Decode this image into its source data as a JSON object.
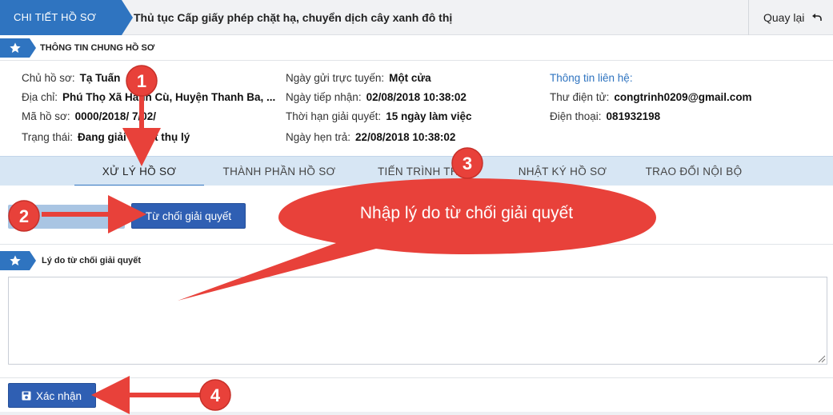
{
  "header": {
    "tag": "CHI TIẾT HỒ SƠ",
    "title": "Thủ tục Cấp giấy phép chặt hạ, chuyển dịch cây xanh đô thị",
    "back_label": "Quay lại"
  },
  "general_section": {
    "title": "THÔNG TIN CHUNG HỒ SƠ"
  },
  "info": {
    "owner_label": "Chủ hồ sơ:",
    "owner_value": "Tạ Tuấn",
    "address_label": "Địa chỉ:",
    "address_value": "Phú Thọ Xã Hanh Cù, Huyện Thanh Ba, ...",
    "code_label": "Mã hồ sơ:",
    "code_value": "0000/2018/ 7/02/",
    "status_label": "Trạng thái:",
    "status_value": "Đang giải quyết thụ lý",
    "submit_label": "Ngày gửi trực tuyến:",
    "submit_value": "Một cửa",
    "received_label": "Ngày tiếp nhận:",
    "received_value": "02/08/2018 10:38:02",
    "deadline_label": "Thời hạn giải quyết:",
    "deadline_value": "15 ngày làm việc",
    "appointment_label": "Ngày hẹn trả:",
    "appointment_value": "22/08/2018 10:38:02",
    "contact_title": "Thông tin liên hệ:",
    "email_label": "Thư điện tử:",
    "email_value": "congtrinh0209@gmail.com",
    "phone_label": "Điện thoại:",
    "phone_value": "081932198"
  },
  "tabs": [
    {
      "label": "XỬ LÝ HỒ SƠ",
      "active": true
    },
    {
      "label": "THÀNH PHẦN HỒ SƠ",
      "active": false
    },
    {
      "label": "TIẾN TRÌNH TH",
      "active": false
    },
    {
      "label": "NHẬT KÝ HỒ SƠ",
      "active": false
    },
    {
      "label": "TRAO ĐỔI NỘI BỘ",
      "active": false
    }
  ],
  "actions": {
    "reject_label": "Từ chối giải quyết"
  },
  "reason_section": {
    "title": "Lý do từ chối giải quyết",
    "placeholder": ""
  },
  "footer": {
    "confirm_label": "Xác nhận"
  },
  "annotations": {
    "badges": [
      "1",
      "2",
      "3",
      "4"
    ],
    "bubble_text": "Nhập lý do từ chối giải quyết"
  },
  "colors": {
    "primary": "#2f74c0",
    "button": "#2f5fb3",
    "tab_bar": "#d7e6f4",
    "annotation_red": "#e8413a"
  }
}
